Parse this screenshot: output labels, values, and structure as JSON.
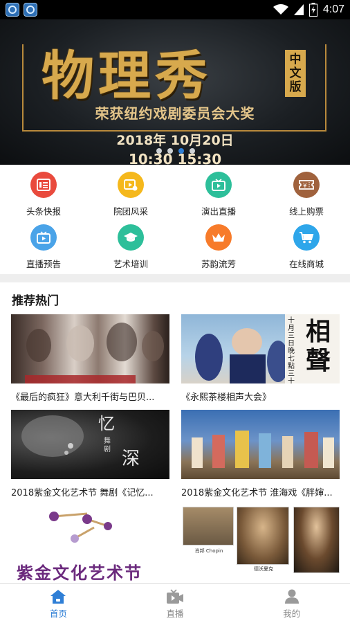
{
  "status_bar": {
    "time": "4:07",
    "battery_icon": "battery-charging-icon",
    "wifi_icon": "wifi-icon",
    "signal_icon": "cell-signal-icon"
  },
  "banner": {
    "title": "物理秀",
    "badge": "中文版",
    "subtitle": "荣获纽约戏剧委员会大奖",
    "date": "2018年 10月20日",
    "time": "10:30 15:30",
    "active_slide": 3,
    "slides": 4
  },
  "quick_menu": [
    {
      "label": "头条快报",
      "icon": "news-icon",
      "color": "#e94a3d"
    },
    {
      "label": "院团风采",
      "icon": "video-tag-icon",
      "color": "#f5b81c"
    },
    {
      "label": "演出直播",
      "icon": "tv-play-icon",
      "color": "#2dbf9a"
    },
    {
      "label": "线上购票",
      "icon": "ticket-icon",
      "color": "#a0623d"
    },
    {
      "label": "直播预告",
      "icon": "tv-play-icon",
      "color": "#4aa3e8"
    },
    {
      "label": "艺术培训",
      "icon": "graduation-cap-icon",
      "color": "#2dbf9a"
    },
    {
      "label": "苏韵流芳",
      "icon": "crown-icon",
      "color": "#f77b2a"
    },
    {
      "label": "在线商城",
      "icon": "cart-icon",
      "color": "#2ea6ea"
    }
  ],
  "recommended": {
    "title": "推荐热门",
    "cards": [
      {
        "caption": "《最后的疯狂》意大利千街与巴贝..."
      },
      {
        "caption": "《永熙茶楼相声大会》"
      },
      {
        "caption": "2018紫金文化艺术节 舞剧《记忆..."
      },
      {
        "caption": "2018紫金文化艺术节 淮海戏《胖婶..."
      }
    ],
    "poster_texts": {
      "card2_vertical": "十月三日晚七點三十",
      "card2_big": "相聲",
      "card3_big1": "忆",
      "card3_big2": "深",
      "card3_small": "舞剧",
      "card5_heading": "紫金文化艺术节",
      "card6_portrait1": "肖邦 Chopin",
      "card6_portrait2": "德沃夏克"
    }
  },
  "bottom_nav": [
    {
      "label": "首页",
      "icon": "home-icon",
      "active": true
    },
    {
      "label": "直播",
      "icon": "video-camera-icon",
      "active": false
    },
    {
      "label": "我的",
      "icon": "user-icon",
      "active": false
    }
  ]
}
